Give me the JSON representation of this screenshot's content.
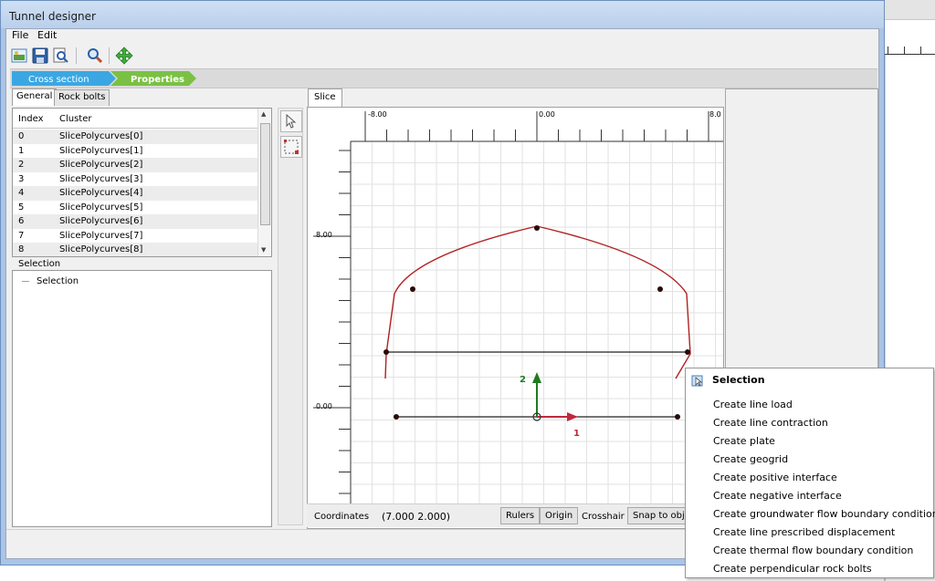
{
  "window": {
    "title": "Tunnel designer"
  },
  "menu": {
    "file": "File",
    "edit": "Edit"
  },
  "toolbar": {
    "icons": [
      "open-image-icon",
      "save-icon",
      "print-preview-icon",
      "zoom-icon",
      "move-icon"
    ]
  },
  "wizard": {
    "steps": [
      {
        "label": "Cross section",
        "color": "#3aa7e3"
      },
      {
        "label": "Properties",
        "color": "#7ac143"
      }
    ]
  },
  "tabs": {
    "general": "General",
    "rock_bolts": "Rock bolts"
  },
  "table": {
    "headers": {
      "index": "Index",
      "cluster": "Cluster"
    },
    "rows": [
      {
        "index": "0",
        "cluster": "SlicePolycurves[0]"
      },
      {
        "index": "1",
        "cluster": "SlicePolycurves[1]"
      },
      {
        "index": "2",
        "cluster": "SlicePolycurves[2]"
      },
      {
        "index": "3",
        "cluster": "SlicePolycurves[3]"
      },
      {
        "index": "4",
        "cluster": "SlicePolycurves[4]"
      },
      {
        "index": "5",
        "cluster": "SlicePolycurves[5]"
      },
      {
        "index": "6",
        "cluster": "SlicePolycurves[6]"
      },
      {
        "index": "7",
        "cluster": "SlicePolycurves[7]"
      },
      {
        "index": "8",
        "cluster": "SlicePolycurves[8]"
      }
    ]
  },
  "selection": {
    "label": "Selection",
    "tree_item": "Selection"
  },
  "slice": {
    "tab": "Slice",
    "ruler_top": [
      "-8.00",
      "0.00",
      "8.0"
    ],
    "ruler_left": [
      "8.00",
      "0.00"
    ],
    "axis_labels": {
      "axis1": "1",
      "axis2": "2"
    },
    "colors": {
      "curve": "#b22020",
      "axis1": "#c0283c",
      "axis2": "#1f7a1f",
      "grid": "#e2e2e2"
    }
  },
  "status": {
    "coordinates_label": "Coordinates",
    "coordinates_value": "(7.000 2.000)",
    "rulers": "Rulers",
    "origin": "Origin",
    "crosshair": "Crosshair",
    "snap": "Snap to objec"
  },
  "context_menu": {
    "title": "Selection",
    "items": [
      "Create line load",
      "Create line contraction",
      "Create plate",
      "Create geogrid",
      "Create positive interface",
      "Create negative interface",
      "Create groundwater flow boundary condition",
      "Create line prescribed displacement",
      "Create thermal flow boundary condition",
      "Create perpendicular rock bolts"
    ]
  }
}
